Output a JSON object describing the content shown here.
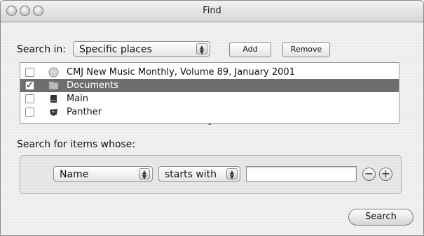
{
  "window": {
    "title": "Find",
    "buttons": [
      "close",
      "minimize",
      "zoom"
    ]
  },
  "search_in": {
    "label": "Search in:",
    "selected": "Specific places",
    "add_label": "Add",
    "remove_label": "Remove"
  },
  "places": [
    {
      "label": "CMJ New Music Monthly, Volume 89, January 2001",
      "checked": false,
      "selected": false,
      "icon": "cd-icon"
    },
    {
      "label": "Documents",
      "checked": true,
      "selected": true,
      "icon": "folder-icon"
    },
    {
      "label": "Main",
      "checked": false,
      "selected": false,
      "icon": "hard-drive-icon"
    },
    {
      "label": "Panther",
      "checked": false,
      "selected": false,
      "icon": "panther-drive-icon"
    }
  ],
  "criteria": {
    "label": "Search for items whose:",
    "attribute": "Name",
    "operator": "starts with",
    "value": ""
  },
  "search_button_label": "Search",
  "colors": {
    "selection": "#6e6e6e",
    "background": "#efefef"
  }
}
